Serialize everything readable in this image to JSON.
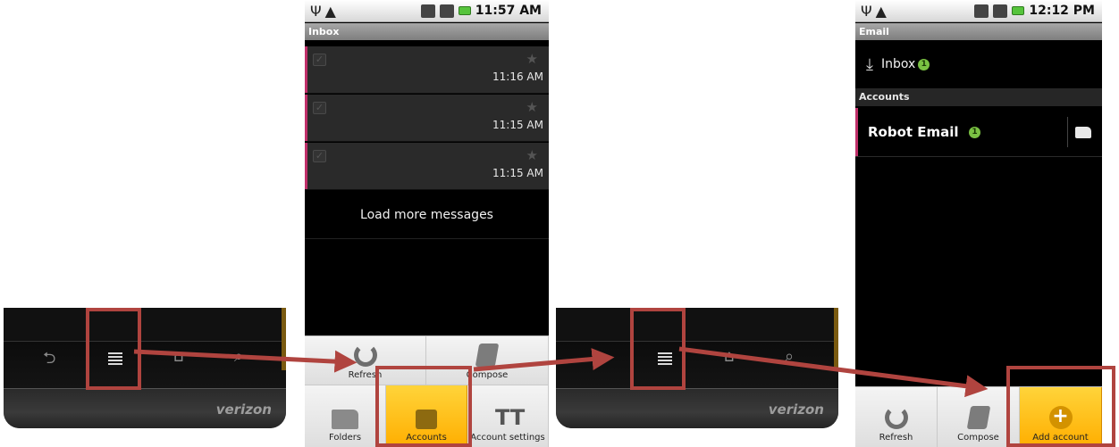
{
  "bezel_left": {
    "brand": "verizon",
    "back_key": "⮌",
    "home_key": "⌂",
    "search_key": "⌕"
  },
  "bezel_right": {
    "brand": "verizon",
    "back_key": "⮌",
    "home_key": "⌂",
    "search_key": "⌕"
  },
  "inbox_screen": {
    "status": {
      "time": "11:57 AM"
    },
    "title": "Inbox",
    "messages": [
      {
        "time": "11:16 AM"
      },
      {
        "time": "11:15 AM"
      },
      {
        "time": "11:15 AM"
      }
    ],
    "load_more": "Load more messages",
    "menu": {
      "refresh": "Refresh",
      "compose": "Compose",
      "folders": "Folders",
      "accounts": "Accounts",
      "account_settings": "Account settings"
    }
  },
  "email_screen": {
    "status": {
      "time": "12:12 PM"
    },
    "title": "Email",
    "inbox": {
      "label": "Inbox",
      "count": "1"
    },
    "accounts_header": "Accounts",
    "account": {
      "name": "Robot Email",
      "count": "1"
    },
    "menu": {
      "refresh": "Refresh",
      "compose": "Compose",
      "add_account": "Add account"
    }
  },
  "colors": {
    "annotation": "#b0443f",
    "highlight": "#ffb800",
    "unread": "#c0306a",
    "badge": "#7ac143"
  }
}
